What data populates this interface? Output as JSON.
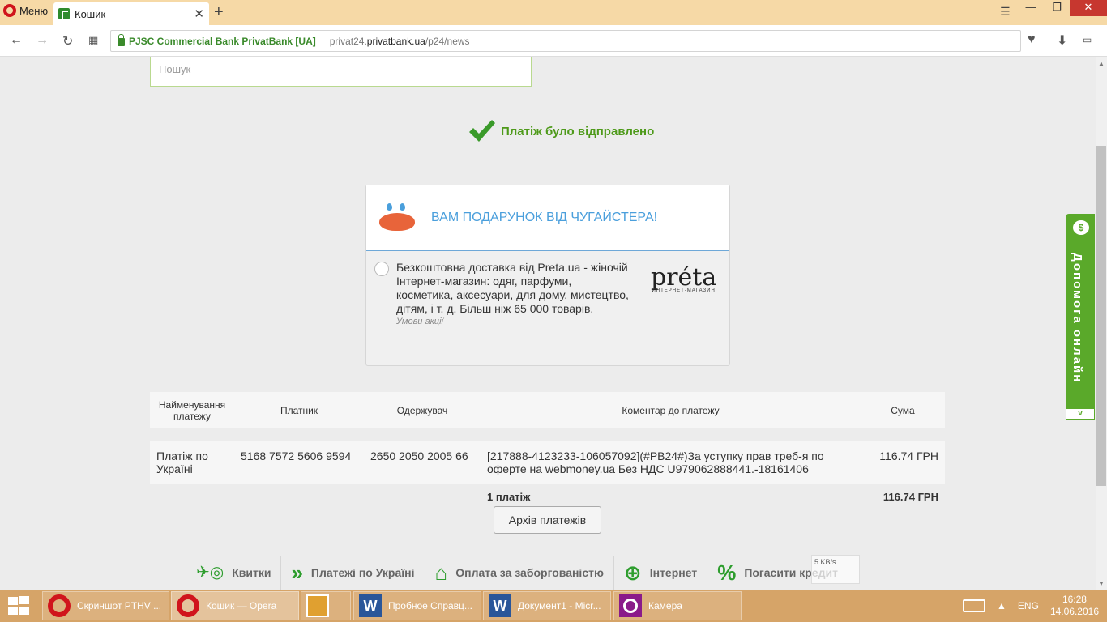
{
  "browser": {
    "menu_label": "Меню",
    "tab_title": "Кошик",
    "secure_label": "PJSC Commercial Bank PrivatBank [UA]",
    "url_prefix": "privat24.",
    "url_host": "privatbank.ua",
    "url_path": "/p24/news"
  },
  "search": {
    "placeholder": "Пошук"
  },
  "status": {
    "message": "Платіж було відправлено"
  },
  "gift": {
    "title": "ВАМ ПОДАРУНОК ВІД ЧУГАЙСТЕРА!",
    "offer_text": "Безкоштовна доставка від Preta.ua - жіночій Інтернет-магазин: одяг, парфуми, косметика, аксесуари, для дому, мистецтво, дітям, і т. д. Більш ніж 65 000 товарів.",
    "terms_link": "Умови акції",
    "partner_logo": "préta",
    "partner_sub": "ИНТЕРНЕТ-МАГАЗИН"
  },
  "payments_table": {
    "headers": [
      "Найменування платежу",
      "Платник",
      "Одержувач",
      "Коментар до платежу",
      "Сума"
    ],
    "rows": [
      {
        "name": "Платіж по Україні",
        "payer": "5168 7572 5606 9594",
        "recipient": "2650 2050 2005 66",
        "comment": "[217888-4123233-106057092](#PB24#)За уступку прав треб-я по оферте на webmoney.ua Без НДС U979062888441.-18161406",
        "amount": "116.74 ГРН"
      }
    ],
    "total_count": "1 платіж",
    "total_amount": "116.74 ГРН"
  },
  "archive_button": "Архів платежів",
  "bottom_nav": [
    {
      "label": "Квитки",
      "icon": "tickets-icon"
    },
    {
      "label": "Платежі по Україні",
      "icon": "chevrons-icon"
    },
    {
      "label": "Оплата за заборгованістю",
      "icon": "house-icon"
    },
    {
      "label": "Інтернет",
      "icon": "globe-icon"
    },
    {
      "label": "Погасити кредит",
      "icon": "percent-down-icon"
    }
  ],
  "help_widget": {
    "label": "Допомога онлайн"
  },
  "net_speed": "5 KB/s",
  "taskbar": {
    "items": [
      {
        "label": "Скриншот PTHV ...",
        "app": "opera"
      },
      {
        "label": "Кошик — Opera",
        "app": "opera"
      },
      {
        "label": "",
        "app": "media"
      },
      {
        "label": "Пробное Справц...",
        "app": "word"
      },
      {
        "label": "Документ1 - Micr...",
        "app": "word"
      },
      {
        "label": "Камера",
        "app": "camera"
      }
    ],
    "language": "ENG",
    "time": "16:28",
    "date": "14.06.2016"
  },
  "colors": {
    "success_green": "#4e9a1a",
    "gift_blue": "#4a9fdc",
    "help_green": "#5aa92a",
    "taskbar": "#d6a468"
  }
}
